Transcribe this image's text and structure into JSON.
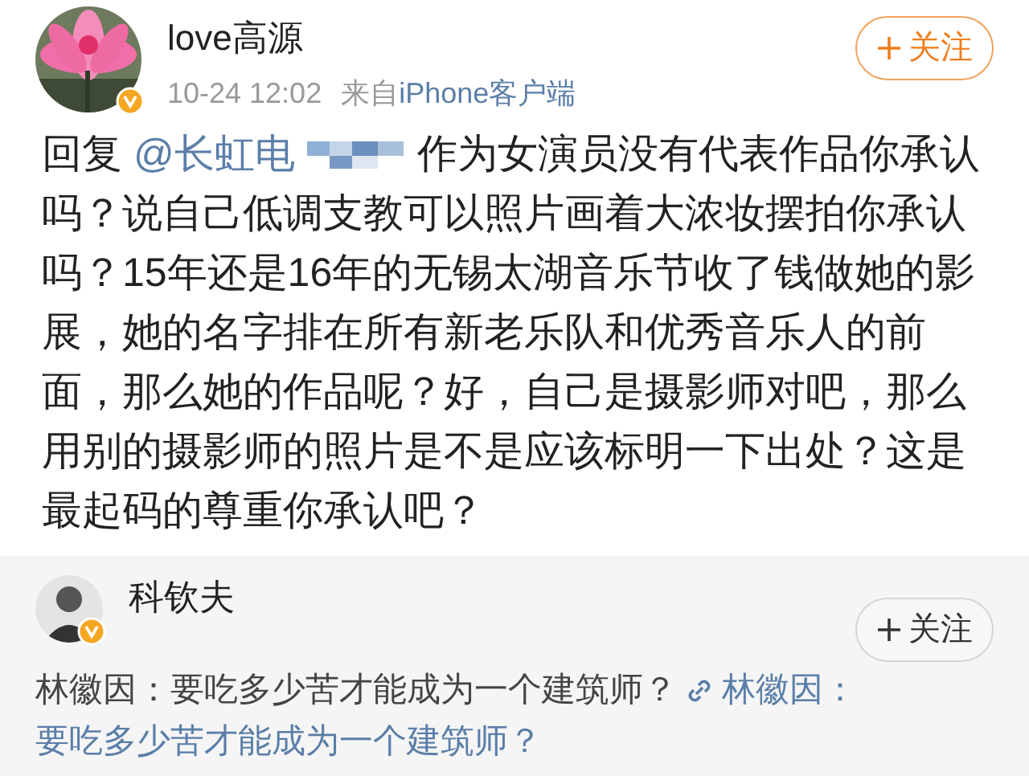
{
  "post": {
    "author": "love高源",
    "verified": true,
    "time": "10-24 12:02",
    "source_prefix": "来自",
    "source": "iPhone客户端",
    "follow_button": {
      "label": "关注",
      "kind": "accent"
    },
    "reply_prefix": "回复",
    "mention": "@长虹电",
    "mention_blurred": true,
    "text": "作为女演员没有代表作品你承认吗？说自己低调支教可以照片画着大浓妆摆拍你承认吗？15年还是16年的无锡太湖音乐节收了钱做她的影展，她的名字排在所有新老乐队和优秀音乐人的前面，那么她的作品呢？好，自己是摄影师对吧，那么用别的摄影师的照片是不是应该标明一下出处？这是最起码的尊重你承认吧？"
  },
  "repost": {
    "author": "科钦夫",
    "verified": true,
    "follow_button": {
      "label": "关注",
      "kind": "plain"
    },
    "text": "林徽因：要吃多少苦才能成为一个建筑师？",
    "link_lines": [
      "林徽因：",
      "要吃多少苦才能成为一个建筑师？"
    ]
  }
}
